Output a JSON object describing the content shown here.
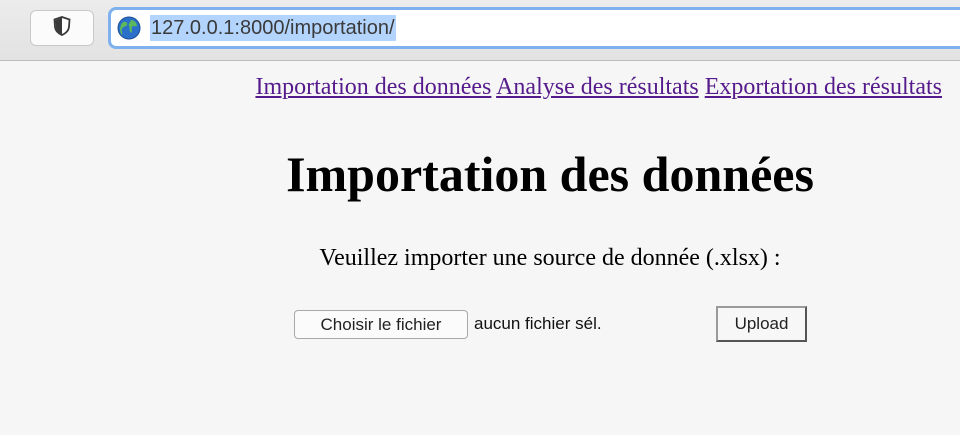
{
  "browser": {
    "url": "127.0.0.1:8000/importation/",
    "shield_icon": "shield-icon",
    "globe_icon": "globe-icon"
  },
  "nav": {
    "links": [
      {
        "label": "Importation des données"
      },
      {
        "label": "Analyse des résultats"
      },
      {
        "label": "Exportation des résultats"
      }
    ],
    "link_color": "#551a8b"
  },
  "main": {
    "title": "Importation des données",
    "prompt": "Veuillez importer une source de donnée (.xlsx) :",
    "file_button_label": "Choisir le fichier",
    "file_status": "aucun fichier sél.",
    "upload_label": "Upload"
  },
  "colors": {
    "url_selection": "#b3d4fc",
    "url_focus_ring": "#7fb1ee"
  }
}
